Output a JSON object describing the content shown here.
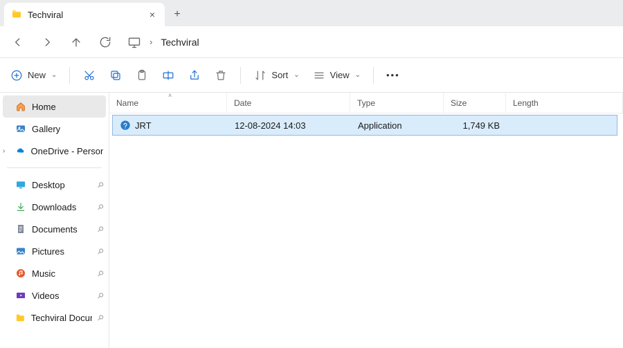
{
  "tab": {
    "title": "Techviral"
  },
  "address": {
    "location": "Techviral"
  },
  "toolbar": {
    "new": "New",
    "sort": "Sort",
    "view": "View"
  },
  "sidebar": {
    "primary": [
      {
        "label": "Home",
        "icon": "home",
        "selected": true
      },
      {
        "label": "Gallery",
        "icon": "gallery"
      },
      {
        "label": "OneDrive - Persona",
        "icon": "onedrive",
        "expandable": true
      }
    ],
    "quick": [
      {
        "label": "Desktop",
        "icon": "desktop"
      },
      {
        "label": "Downloads",
        "icon": "downloads"
      },
      {
        "label": "Documents",
        "icon": "documents"
      },
      {
        "label": "Pictures",
        "icon": "pictures"
      },
      {
        "label": "Music",
        "icon": "music"
      },
      {
        "label": "Videos",
        "icon": "videos"
      },
      {
        "label": "Techviral Docum",
        "icon": "folder"
      }
    ]
  },
  "columns": {
    "name": "Name",
    "date": "Date",
    "type": "Type",
    "size": "Size",
    "length": "Length"
  },
  "files": [
    {
      "name": "JRT",
      "date": "12-08-2024 14:03",
      "type": "Application",
      "size": "1,749 KB",
      "length": ""
    }
  ]
}
